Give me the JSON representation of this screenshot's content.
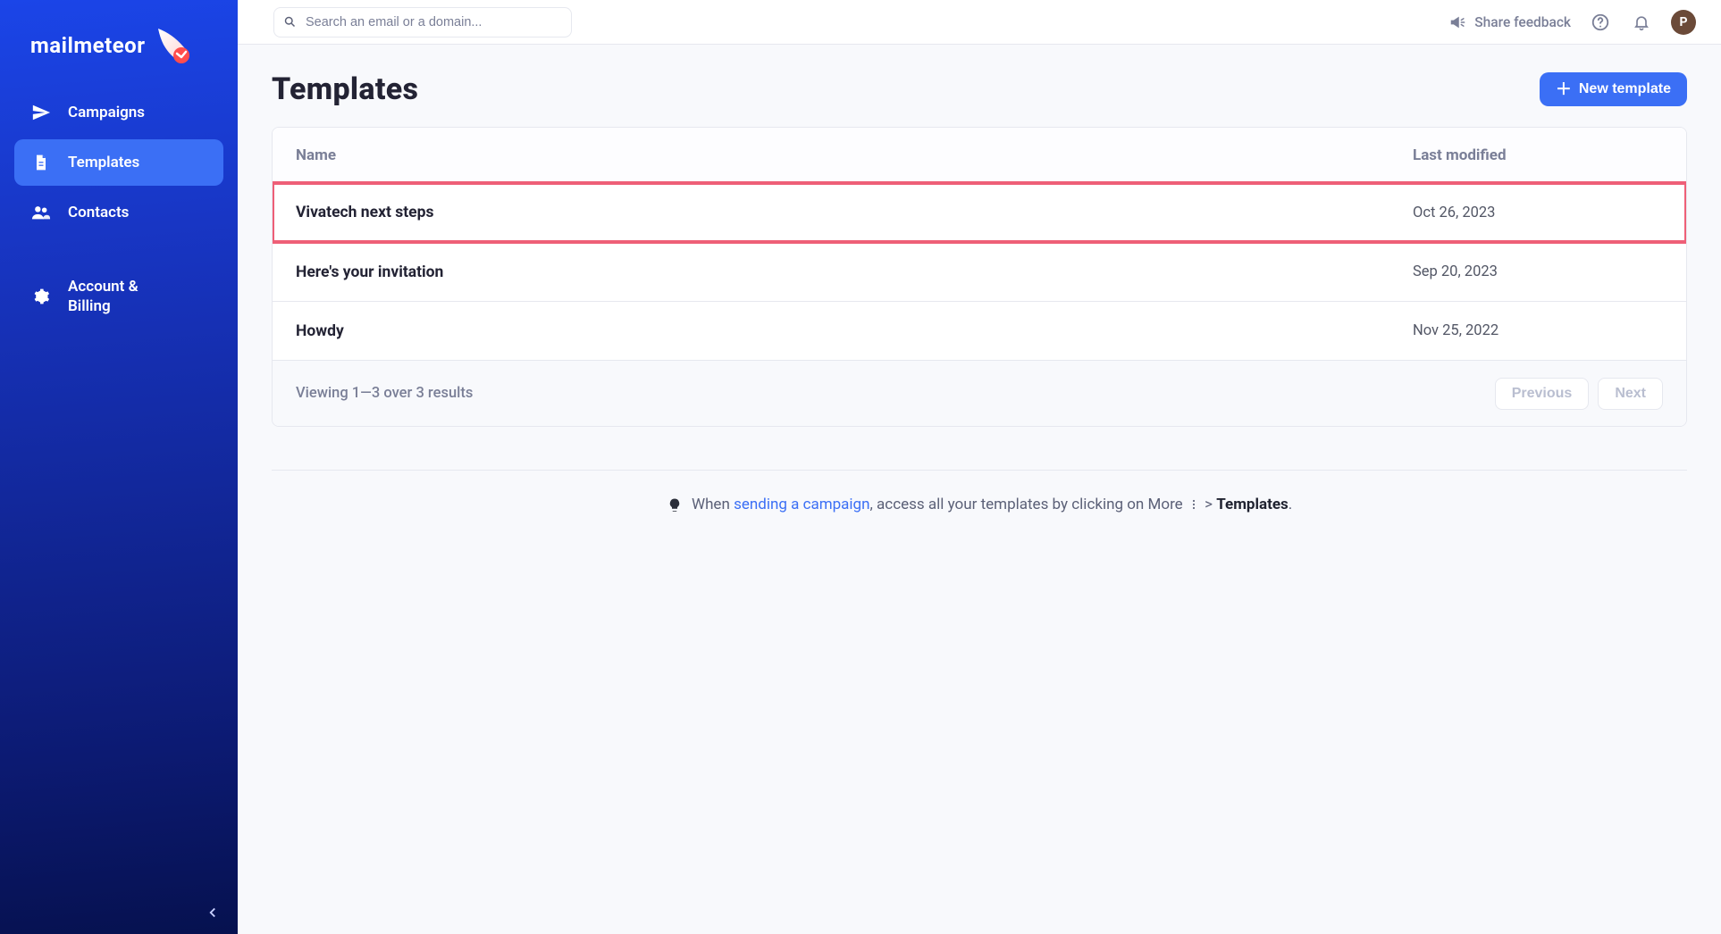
{
  "brand": {
    "name": "mailmeteor"
  },
  "sidebar": {
    "items": [
      {
        "label": "Campaigns"
      },
      {
        "label": "Templates"
      },
      {
        "label": "Contacts"
      },
      {
        "label": "Account & Billing"
      }
    ]
  },
  "topbar": {
    "search_placeholder": "Search an email or a domain...",
    "share_feedback": "Share feedback",
    "avatar_initial": "P"
  },
  "page": {
    "title": "Templates",
    "new_button": "New template"
  },
  "table": {
    "columns": {
      "name": "Name",
      "last_modified": "Last modified"
    },
    "rows": [
      {
        "name": "Vivatech next steps",
        "last_modified": "Oct 26, 2023",
        "highlight": true
      },
      {
        "name": "Here's your invitation",
        "last_modified": "Sep 20, 2023"
      },
      {
        "name": "Howdy",
        "last_modified": "Nov 25, 2022"
      }
    ],
    "footer": {
      "viewing": "Viewing 1—3 over 3 results",
      "previous": "Previous",
      "next": "Next"
    }
  },
  "tip": {
    "prefix": "When ",
    "link_text": "sending a campaign",
    "middle": ", access all your templates by clicking on More ",
    "sep": " > ",
    "strong": "Templates",
    "suffix": "."
  }
}
